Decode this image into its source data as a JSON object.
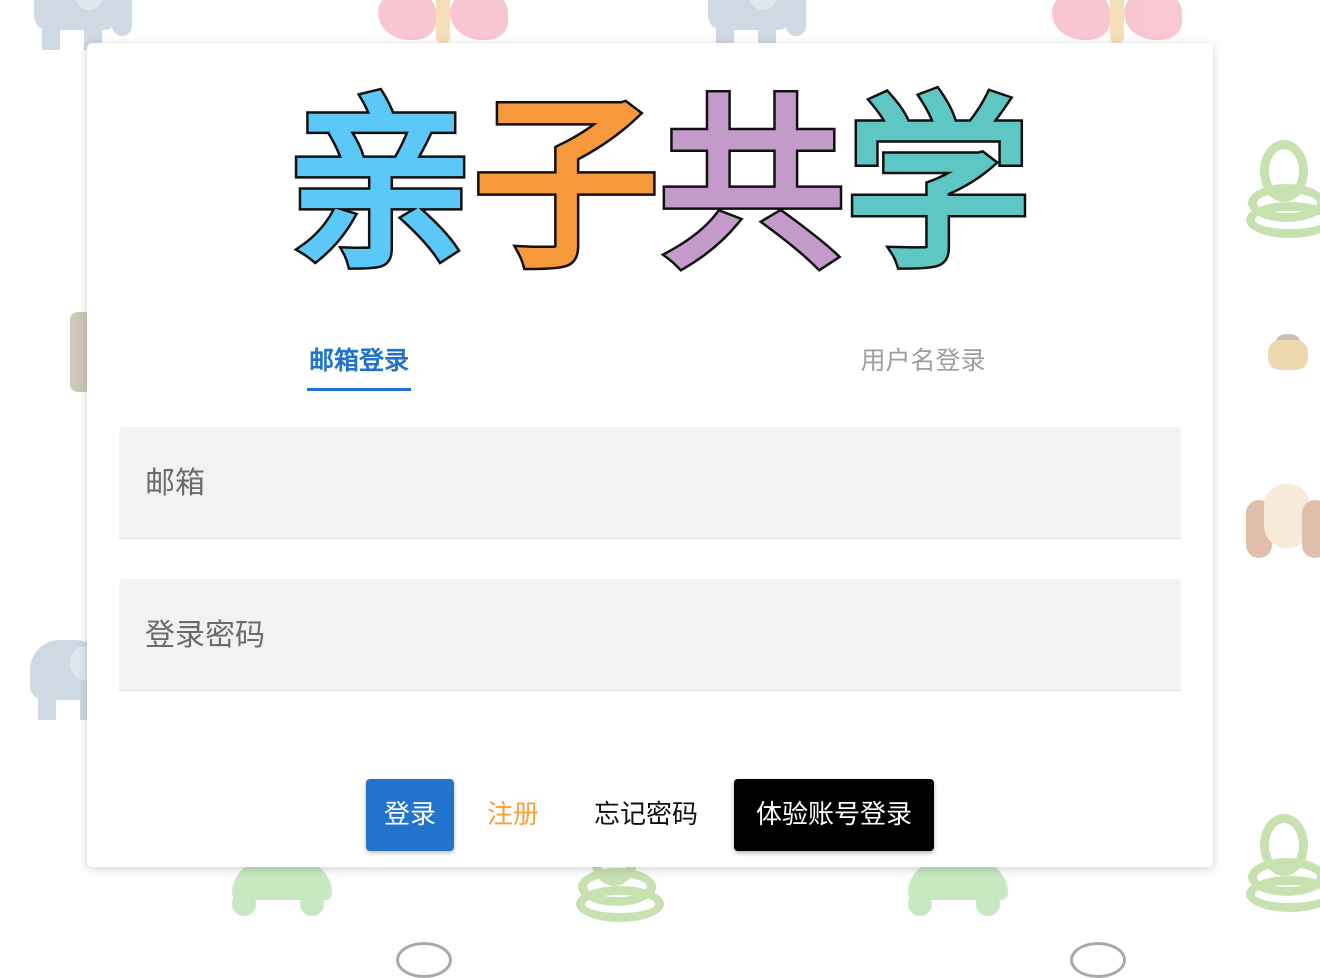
{
  "brand": {
    "title_chars": [
      {
        "char": "亲",
        "color": "#5bc8f7"
      },
      {
        "char": "子",
        "color": "#f7993a"
      },
      {
        "char": "共",
        "color": "#c49acb"
      },
      {
        "char": "学",
        "color": "#5ec7c3"
      }
    ]
  },
  "tabs": [
    {
      "label": "邮箱登录",
      "active": true
    },
    {
      "label": "用户名登录",
      "active": false
    }
  ],
  "form": {
    "email_placeholder": "邮箱",
    "password_placeholder": "登录密码"
  },
  "actions": {
    "login": "登录",
    "register": "注册",
    "forgot": "忘记密码",
    "demo_login": "体验账号登录"
  },
  "colors": {
    "primary": "#2173cc",
    "register": "#f7a137",
    "demo": "#000000"
  }
}
